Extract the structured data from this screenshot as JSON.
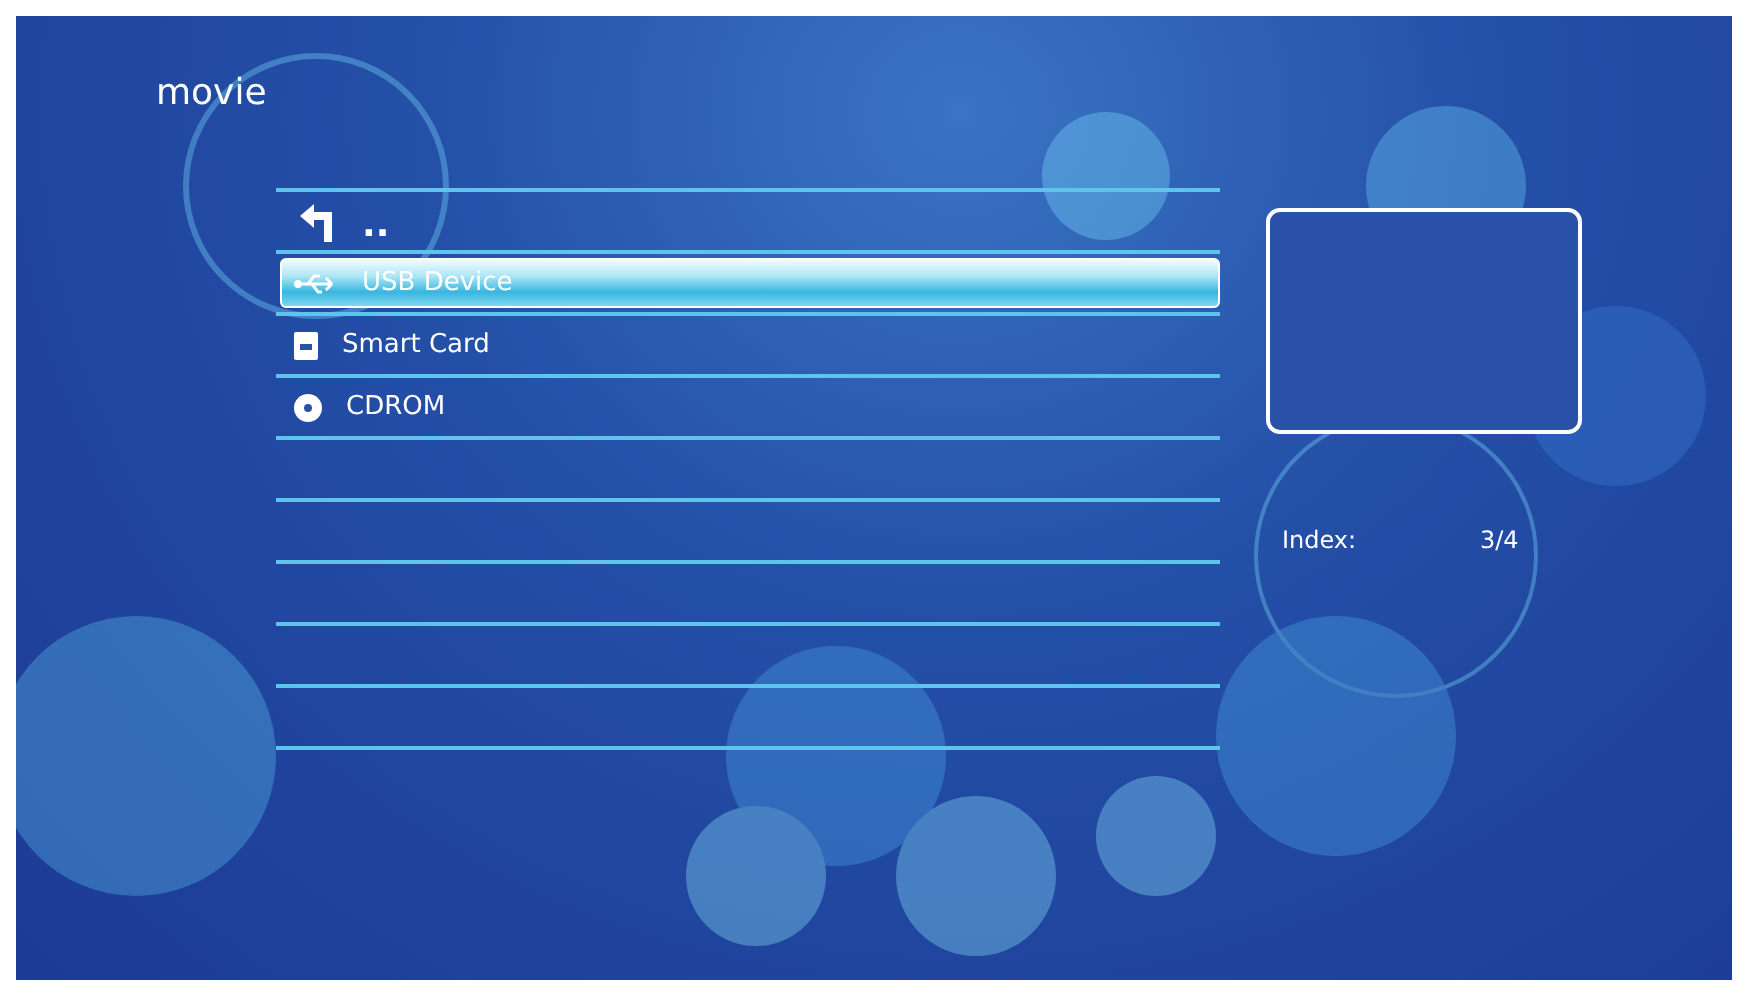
{
  "title": "movie",
  "items": [
    {
      "kind": "up",
      "label": "..",
      "selected": false
    },
    {
      "kind": "usb",
      "label": "USB Device",
      "selected": true
    },
    {
      "kind": "card",
      "label": "Smart Card",
      "selected": false
    },
    {
      "kind": "disc",
      "label": "CDROM",
      "selected": false
    }
  ],
  "info": {
    "label": "Index:",
    "value": "3/4"
  }
}
